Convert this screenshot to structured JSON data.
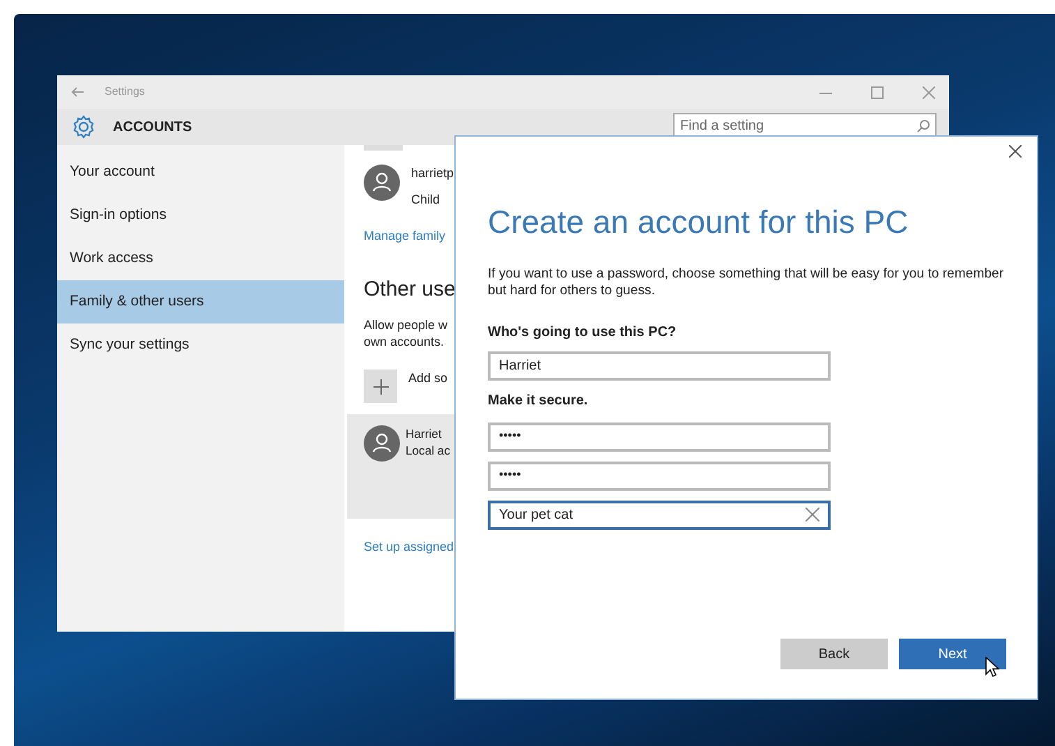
{
  "settings_window": {
    "title": "Settings",
    "header": "ACCOUNTS",
    "search": {
      "placeholder": "Find a setting"
    },
    "sidebar": {
      "items": [
        {
          "label": "Your account",
          "selected": false
        },
        {
          "label": "Sign-in options",
          "selected": false
        },
        {
          "label": "Work access",
          "selected": false
        },
        {
          "label": "Family & other users",
          "selected": true
        },
        {
          "label": "Sync your settings",
          "selected": false
        }
      ]
    },
    "content": {
      "family_member": {
        "name": "harrietp",
        "role": "Child"
      },
      "manage_link": "Manage family",
      "section_title": "Other use",
      "description": [
        "Allow people w",
        "own accounts."
      ],
      "add_label": "Add so",
      "other_user": {
        "name": "Harriet",
        "type": "Local ac",
        "selected": true
      },
      "assigned_access_link": "Set up assigned"
    }
  },
  "dialog": {
    "title": "Create an account for this PC",
    "intro": "If you want to use a password, choose something that will be easy for you to remember but hard for others to guess.",
    "name_label": "Who's going to use this PC?",
    "name_value": "Harriet",
    "secure_label": "Make it secure.",
    "fields": [
      {
        "kind": "password",
        "value": "•••••",
        "focused": false
      },
      {
        "kind": "password",
        "value": "•••••",
        "focused": false
      },
      {
        "kind": "hint",
        "value": "Your pet cat",
        "focused": true
      }
    ],
    "buttons": [
      {
        "label": "Back",
        "kind": "secondary"
      },
      {
        "label": "Next",
        "kind": "primary"
      }
    ]
  }
}
